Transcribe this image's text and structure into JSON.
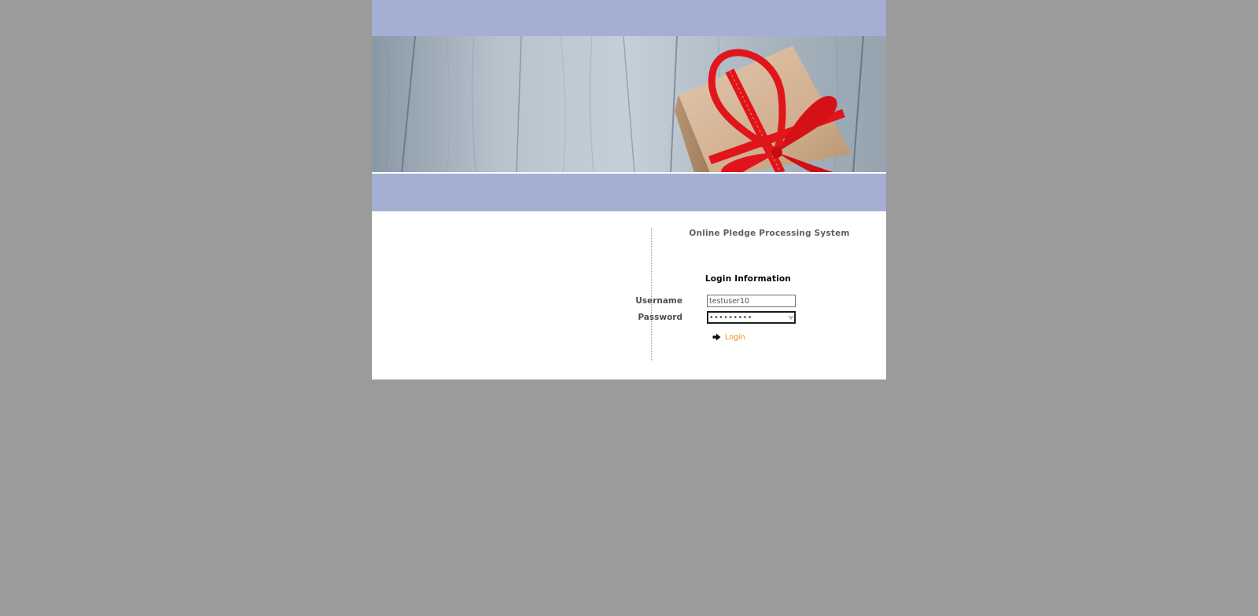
{
  "app": {
    "system_title": "Online Pledge Processing System"
  },
  "banner": {
    "image": "gift-box-with-red-ribbon-on-wooden-boards"
  },
  "login": {
    "heading": "Login Information",
    "username_label": "Username",
    "username_value": "testuser10",
    "password_label": "Password",
    "password_value": "testuser1",
    "submit_label": "Login"
  },
  "colors": {
    "page_background": "#9b9b9b",
    "band": "#a5afd3",
    "link": "#ef8a17"
  },
  "icons": {
    "login_arrow": "arrow-right-icon",
    "password_reveal": "password-reveal-icon"
  }
}
